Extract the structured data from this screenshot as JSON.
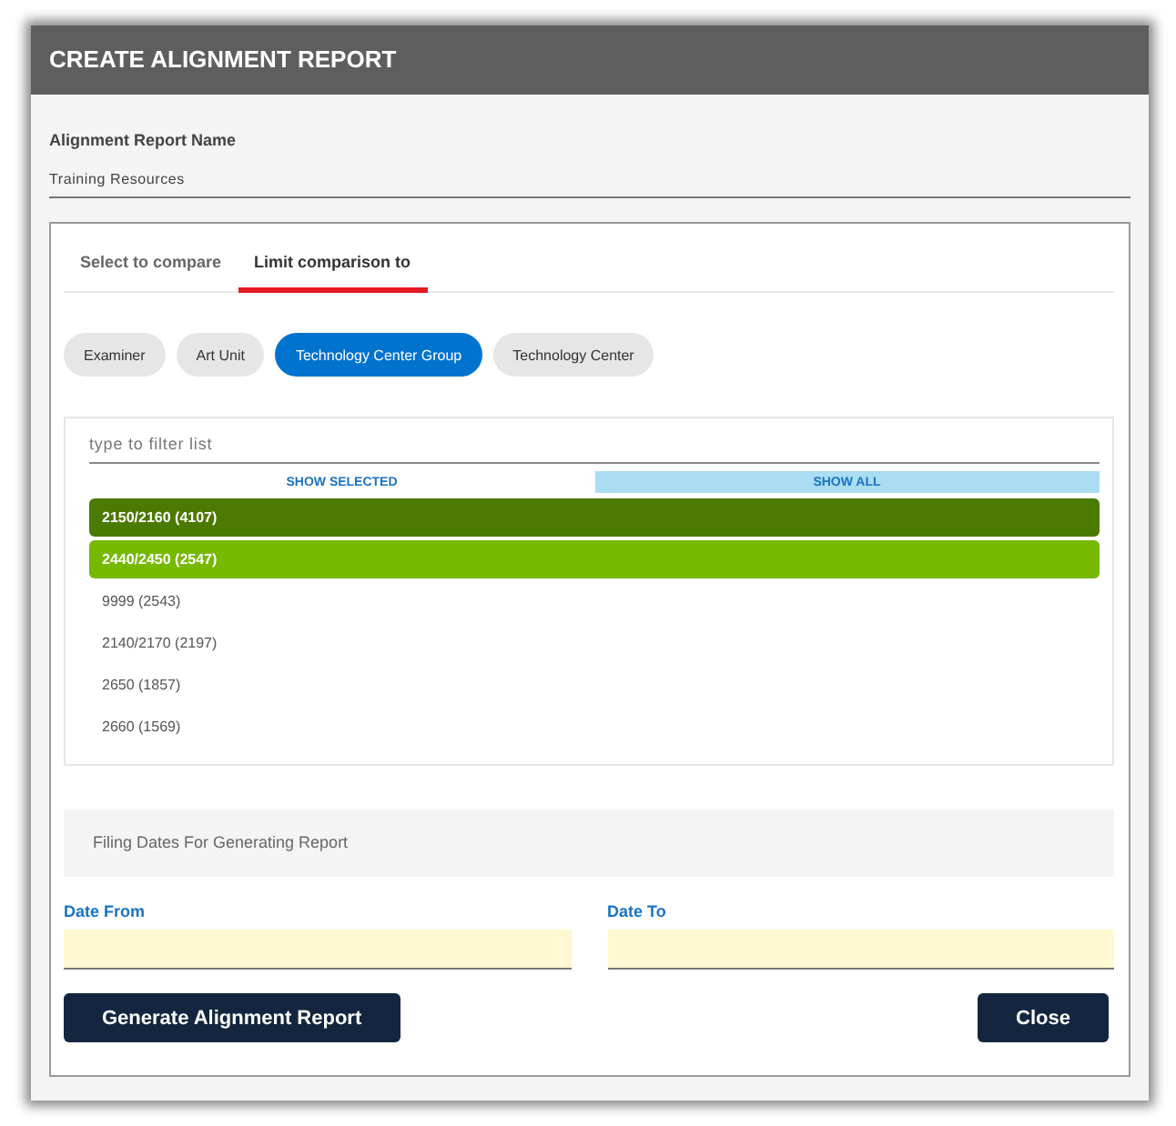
{
  "window": {
    "title": "CREATE ALIGNMENT REPORT"
  },
  "report_name": {
    "label": "Alignment Report Name",
    "value": "Training Resources"
  },
  "tabs": [
    {
      "label": "Select to compare",
      "selected": false
    },
    {
      "label": "Limit comparison to",
      "selected": true
    }
  ],
  "chips": [
    {
      "label": "Examiner",
      "selected": false
    },
    {
      "label": "Art Unit",
      "selected": false
    },
    {
      "label": "Technology Center Group",
      "selected": true
    },
    {
      "label": "Technology Center",
      "selected": false
    }
  ],
  "filter": {
    "placeholder": "type to filter list"
  },
  "view_toggle": [
    {
      "label": "SHOW SELECTED",
      "selected": false
    },
    {
      "label": "SHOW ALL",
      "selected": true
    }
  ],
  "list_items": [
    {
      "label": "2150/2160 (4107)",
      "selected": true,
      "color": "#4b7a00"
    },
    {
      "label": "2440/2450 (2547)",
      "selected": true,
      "color": "#76b900"
    },
    {
      "label": "9999 (2543)",
      "selected": false
    },
    {
      "label": "2140/2170 (2197)",
      "selected": false
    },
    {
      "label": "2650 (1857)",
      "selected": false
    },
    {
      "label": "2660 (1569)",
      "selected": false
    }
  ],
  "dates_section": {
    "title": "Filing Dates For Generating Report"
  },
  "date_fields": [
    {
      "label": "Date From"
    },
    {
      "label": "Date To"
    }
  ],
  "buttons": [
    {
      "label": "Generate Alignment Report"
    },
    {
      "label": "Close"
    }
  ]
}
